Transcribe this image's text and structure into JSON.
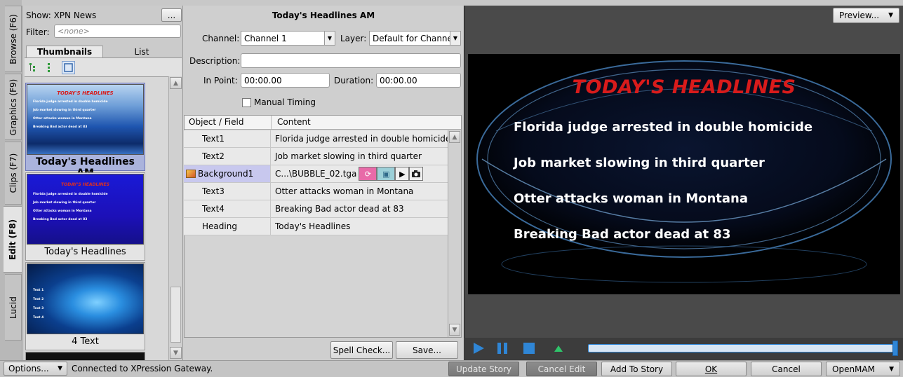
{
  "browser": {
    "show_label": "Show: XPN News",
    "show_more": "...",
    "filter_label": "Filter:",
    "filter_value": "<none>",
    "view_tabs": [
      "Thumbnails",
      "List"
    ]
  },
  "side_tabs": [
    "Browse (F6)",
    "Graphics (F9)",
    "Clips (F7)",
    "Edit (F8)",
    "Lucid"
  ],
  "thumbnails": [
    {
      "caption": "Today's Headlines AM",
      "heading": "TODAY'S HEADLINES",
      "lines": [
        "Florida judge arrested in double homicide",
        "Job market slowing in third quarter",
        "Otter attacks woman in Montana",
        "Breaking Bad actor dead at 83"
      ]
    },
    {
      "caption": "Today's Headlines",
      "heading": "TODAY'S HEADLINES",
      "lines": [
        "Florida judge arrested in double homicide",
        "Job market slowing in third quarter",
        "Otter attacks woman in Montana",
        "Breaking Bad actor dead at 83"
      ]
    },
    {
      "caption": "4 Text",
      "lines": [
        "Text 1",
        "Text 2",
        "Text 3",
        "Text 4"
      ]
    }
  ],
  "editor": {
    "title": "Today's Headlines AM",
    "channel_label": "Channel:",
    "channel_value": "Channel 1",
    "layer_label": "Layer:",
    "layer_value": "Default for Channe",
    "description_label": "Description:",
    "description_value": "",
    "inpoint_label": "In Point:",
    "inpoint_value": "00:00.00",
    "duration_label": "Duration:",
    "duration_value": "00:00.00",
    "manual_timing_label": "Manual Timing",
    "col_field": "Object / Field",
    "col_content": "Content",
    "rows": [
      {
        "field": "Text1",
        "content": "Florida judge arrested in double homicide"
      },
      {
        "field": "Text2",
        "content": "Job market slowing in third quarter"
      },
      {
        "field": "Background1",
        "content": "C...\\BUBBLE_02.tga"
      },
      {
        "field": "Text3",
        "content": "Otter attacks woman in Montana"
      },
      {
        "field": "Text4",
        "content": "Breaking Bad actor dead at 83"
      },
      {
        "field": "Heading",
        "content": "Today's Headlines"
      }
    ],
    "spell_check": "Spell Check...",
    "save": "Save..."
  },
  "preview": {
    "button": "Preview...",
    "heading": "TODAY'S HEADLINES",
    "lines": [
      "Florida judge arrested in double homicide",
      "Job market slowing in third quarter",
      "Otter attacks woman in Montana",
      "Breaking Bad actor dead at 83"
    ]
  },
  "statusbar": {
    "options": "Options...",
    "status": "Connected to XPression Gateway.",
    "update_story": "Update Story",
    "cancel_edit": "Cancel Edit",
    "add_to_story": "Add To Story",
    "ok": "OK",
    "cancel": "Cancel",
    "openmam": "OpenMAM"
  },
  "colors": {
    "accent_blue": "#2f86d6",
    "heading_red": "#d81b1b",
    "selected_row": "#c8c8ee"
  }
}
